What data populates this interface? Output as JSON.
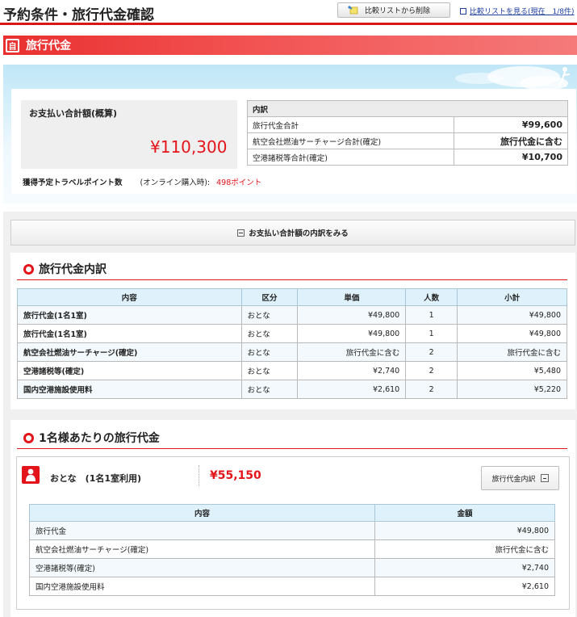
{
  "header": {
    "title": "予約条件・旅行代金確認",
    "remove_compare_label": "比較リストから削除",
    "view_compare_label": "比較リストを見る(現在　1/8件)"
  },
  "section": {
    "icon_text": "自",
    "title": "旅行代金"
  },
  "summary": {
    "total_label": "お支払い合計額(概算)",
    "total_amount": "¥110,300",
    "breakdown_header": "内訳",
    "breakdown": [
      {
        "label": "旅行代金合計",
        "value": "¥99,600"
      },
      {
        "label": "航空会社燃油サーチャージ合計(確定)",
        "value": "旅行代金に含む"
      },
      {
        "label": "空港諸税等合計(確定)",
        "value": "¥10,700"
      }
    ],
    "points_label": "獲得予定トラベルポイント数",
    "points_note": "(オンライン購入時):",
    "points_value": "498ポイント"
  },
  "toggle_label": "お支払い合計額の内訳をみる",
  "breakdown_section": {
    "title": "旅行代金内訳",
    "columns": [
      "内容",
      "区分",
      "単価",
      "人数",
      "小計"
    ],
    "rows": [
      {
        "item": "旅行代金(1名1室)",
        "category": "おとな",
        "unit": "¥49,800",
        "count": "1",
        "subtotal": "¥49,800"
      },
      {
        "item": "旅行代金(1名1室)",
        "category": "おとな",
        "unit": "¥49,800",
        "count": "1",
        "subtotal": "¥49,800"
      },
      {
        "item": "航空会社燃油サーチャージ(確定)",
        "category": "おとな",
        "unit": "旅行代金に含む",
        "count": "2",
        "subtotal": "旅行代金に含む"
      },
      {
        "item": "空港諸税等(確定)",
        "category": "おとな",
        "unit": "¥2,740",
        "count": "2",
        "subtotal": "¥5,480"
      },
      {
        "item": "国内空港施設使用料",
        "category": "おとな",
        "unit": "¥2,610",
        "count": "2",
        "subtotal": "¥5,220"
      }
    ]
  },
  "per_person": {
    "title": "1名様あたりの旅行代金",
    "person_label": "おとな　(1名1室利用)",
    "amount": "¥55,150",
    "detail_button": "旅行代金内訳",
    "columns": [
      "内容",
      "金額"
    ],
    "rows": [
      {
        "item": "旅行代金",
        "amount": "¥49,800"
      },
      {
        "item": "航空会社燃油サーチャージ(確定)",
        "amount": "旅行代金に含む"
      },
      {
        "item": "空港諸税等(確定)",
        "amount": "¥2,740"
      },
      {
        "item": "国内空港施設使用料",
        "amount": "¥2,610"
      }
    ]
  },
  "colors": {
    "accent": "#e3151a",
    "table_header": "#dff2fb"
  }
}
